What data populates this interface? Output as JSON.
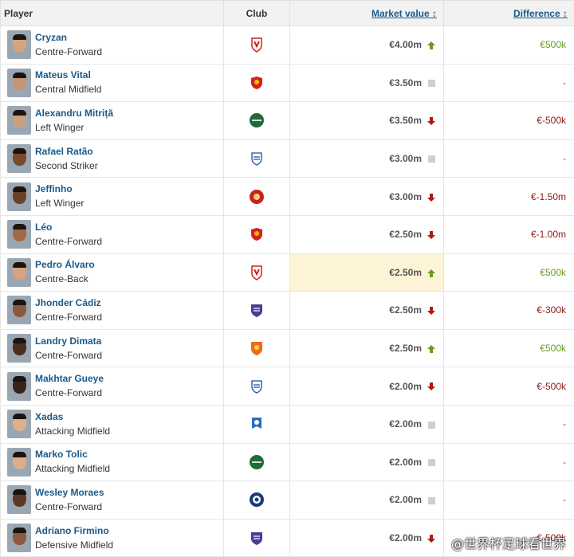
{
  "headers": {
    "player": "Player",
    "club": "Club",
    "market_value": "Market value ↕",
    "difference": "Difference ↕"
  },
  "rows": [
    {
      "name": "Cryzan",
      "position": "Centre-Forward",
      "club_icon": "crest-red-wings",
      "value": "€4.00m",
      "trend": "up",
      "difference": "€500k",
      "diff_sign": "pos",
      "skin": "#d9a37a"
    },
    {
      "name": "Mateus Vital",
      "position": "Central Midfield",
      "club_icon": "crest-red-shield",
      "value": "€3.50m",
      "trend": "flat",
      "difference": "-",
      "diff_sign": "neu",
      "skin": "#c89370"
    },
    {
      "name": "Alexandru Mitriță",
      "position": "Left Winger",
      "club_icon": "crest-green-round",
      "value": "€3.50m",
      "trend": "down",
      "difference": "€-500k",
      "diff_sign": "neg",
      "skin": "#caa07f"
    },
    {
      "name": "Rafael Ratão",
      "position": "Second Striker",
      "club_icon": "crest-blue-shield",
      "value": "€3.00m",
      "trend": "flat",
      "difference": "-",
      "diff_sign": "neu",
      "skin": "#7a4a30"
    },
    {
      "name": "Jeffinho",
      "position": "Left Winger",
      "club_icon": "crest-red-round",
      "value": "€3.00m",
      "trend": "down",
      "difference": "€-1.50m",
      "diff_sign": "neg",
      "skin": "#6b402a"
    },
    {
      "name": "Léo",
      "position": "Centre-Forward",
      "club_icon": "crest-red-shield",
      "value": "€2.50m",
      "trend": "down",
      "difference": "€-1.00m",
      "diff_sign": "neg",
      "skin": "#a06a48"
    },
    {
      "name": "Pedro Álvaro",
      "position": "Centre-Back",
      "club_icon": "crest-red-wings",
      "value": "€2.50m",
      "trend": "up",
      "difference": "€500k",
      "diff_sign": "pos",
      "skin": "#d8a27e",
      "highlight": true
    },
    {
      "name": "Jhonder Cádiz",
      "position": "Centre-Forward",
      "club_icon": "crest-purple-shield",
      "value": "€2.50m",
      "trend": "down",
      "difference": "€-300k",
      "diff_sign": "neg",
      "skin": "#8a5a3c"
    },
    {
      "name": "Landry Dimata",
      "position": "Centre-Forward",
      "club_icon": "crest-orange-shield",
      "value": "€2.50m",
      "trend": "up",
      "difference": "€500k",
      "diff_sign": "pos",
      "skin": "#4a2e20"
    },
    {
      "name": "Makhtar Gueye",
      "position": "Centre-Forward",
      "club_icon": "crest-blue-shield",
      "value": "€2.00m",
      "trend": "down",
      "difference": "€-500k",
      "diff_sign": "neg",
      "skin": "#3a241a"
    },
    {
      "name": "Xadas",
      "position": "Attacking Midfield",
      "club_icon": "crest-blue-banner",
      "value": "€2.00m",
      "trend": "flat",
      "difference": "-",
      "diff_sign": "neu",
      "skin": "#e0b08a"
    },
    {
      "name": "Marko Tolic",
      "position": "Attacking Midfield",
      "club_icon": "crest-green-round",
      "value": "€2.00m",
      "trend": "flat",
      "difference": "-",
      "diff_sign": "neu",
      "skin": "#dcae8c"
    },
    {
      "name": "Wesley Moraes",
      "position": "Centre-Forward",
      "club_icon": "crest-navy-round",
      "value": "€2.00m",
      "trend": "flat",
      "difference": "-",
      "diff_sign": "neu",
      "skin": "#5a3726"
    },
    {
      "name": "Adriano Firmino",
      "position": "Defensive Midfield",
      "club_icon": "crest-purple-shield",
      "value": "€2.00m",
      "trend": "down",
      "difference": "€-500k",
      "diff_sign": "neg",
      "skin": "#8a5a3a"
    }
  ],
  "watermark": "@世界杯足球看世界"
}
